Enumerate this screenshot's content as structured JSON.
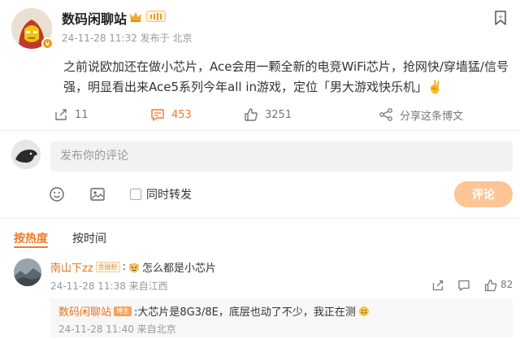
{
  "post": {
    "username": "数码闲聊站",
    "verify_mark": "v",
    "meta": "24-11-28 11:32 发布于 北京",
    "content": "之前说欧加还在做小芯片，Ace会用一颗全新的电竞WiFi芯片，抢网快/穿墙猛/信号强，明显看出来Ace5系列今年all in游戏，定位「男大游戏快乐机」✌️"
  },
  "actions": {
    "repost_count": "11",
    "comment_count": "453",
    "like_count": "3251",
    "share_label": "分享这条博文"
  },
  "composer": {
    "placeholder": "发布你的评论",
    "forward_label": "同时转发",
    "submit_label": "评论"
  },
  "tabs": [
    {
      "label": "按热度"
    },
    {
      "label": "按时间"
    }
  ],
  "comment": {
    "user": "南山下zz",
    "badge": "金融粉",
    "text": "怎么都是小芯片",
    "meta": "24-11-28 11:38 来自江西",
    "like_count": "82"
  },
  "reply": {
    "user": "数码闲聊站",
    "badge": "博主",
    "text": ":大芯片是8G3/8E，底层也动了不少，我正在测",
    "meta": "24-11-28 11:40 来自北京"
  },
  "colors": {
    "accent": "#f07a2a",
    "submit_button": "#fdc596",
    "username_link": "#e8731e"
  },
  "icons": {
    "favorite": "bookmark-icon",
    "repost": "repost-icon",
    "comment": "comment-icon",
    "like": "thumb-up-icon",
    "share": "share-icon",
    "emoji": "smiley-icon",
    "image": "image-icon"
  }
}
